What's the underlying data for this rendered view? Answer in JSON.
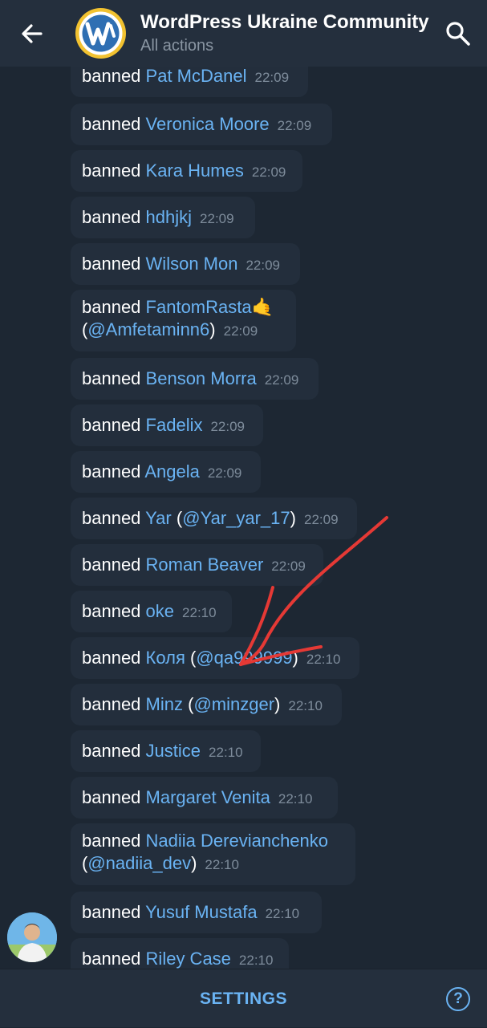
{
  "header": {
    "title": "WordPress Ukraine Community",
    "subtitle": "All actions",
    "back_icon": "arrow-left-icon",
    "search_icon": "search-icon"
  },
  "colors": {
    "background": "#1d2733",
    "bubble": "#232e3c",
    "accent": "#6ab3f3",
    "annotation": "#e53935"
  },
  "log": [
    {
      "verb": "banned",
      "name": "Pat McDanel",
      "handle": "",
      "emoji": "",
      "time": "22:09"
    },
    {
      "verb": "banned",
      "name": "Veronica Moore",
      "handle": "",
      "emoji": "",
      "time": "22:09"
    },
    {
      "verb": "banned",
      "name": "Kara Humes",
      "handle": "",
      "emoji": "",
      "time": "22:09"
    },
    {
      "verb": "banned",
      "name": "hdhjkj",
      "handle": "",
      "emoji": "",
      "time": "22:09"
    },
    {
      "verb": "banned",
      "name": "Wilson Mon",
      "handle": "",
      "emoji": "",
      "time": "22:09"
    },
    {
      "verb": "banned",
      "name": "FantomRasta",
      "handle": "@Amfetaminn6",
      "emoji": "🤙",
      "time": "22:09"
    },
    {
      "verb": "banned",
      "name": "Benson Morra",
      "handle": "",
      "emoji": "",
      "time": "22:09"
    },
    {
      "verb": "banned",
      "name": "Fadelix",
      "handle": "",
      "emoji": "",
      "time": "22:09"
    },
    {
      "verb": "banned",
      "name": "Angela",
      "handle": "",
      "emoji": "",
      "time": "22:09"
    },
    {
      "verb": "banned",
      "name": "Yar",
      "handle": "@Yar_yar_17",
      "emoji": "",
      "time": "22:09"
    },
    {
      "verb": "banned",
      "name": "Roman Beaver",
      "handle": "",
      "emoji": "",
      "time": "22:09"
    },
    {
      "verb": "banned",
      "name": "oke",
      "handle": "",
      "emoji": "",
      "time": "22:10"
    },
    {
      "verb": "banned",
      "name": "Коля",
      "handle": "@qa999999",
      "emoji": "",
      "time": "22:10"
    },
    {
      "verb": "banned",
      "name": "Minz",
      "handle": "@minzger",
      "emoji": "",
      "time": "22:10"
    },
    {
      "verb": "banned",
      "name": "Justice",
      "handle": "",
      "emoji": "",
      "time": "22:10"
    },
    {
      "verb": "banned",
      "name": "Margaret Venita",
      "handle": "",
      "emoji": "",
      "time": "22:10"
    },
    {
      "verb": "banned",
      "name": "Nadiia Derevianchenko",
      "handle": "@nadiia_dev",
      "emoji": "",
      "time": "22:10"
    },
    {
      "verb": "banned",
      "name": "Yusuf Mustafa",
      "handle": "",
      "emoji": "",
      "time": "22:10"
    },
    {
      "verb": "banned",
      "name": "Riley Case",
      "handle": "",
      "emoji": "",
      "time": "22:10"
    }
  ],
  "footer": {
    "settings_label": "SETTINGS",
    "help_icon": "question-circle-icon",
    "help_glyph": "?"
  }
}
